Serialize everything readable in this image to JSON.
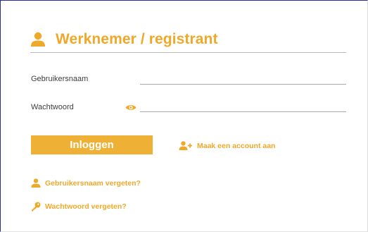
{
  "header": {
    "title": "Werknemer / registrant",
    "icon": "user-icon"
  },
  "form": {
    "username_label": "Gebruikersnaam",
    "username_value": "",
    "password_label": "Wachtwoord",
    "password_value": "",
    "password_toggle_icon": "eye-icon"
  },
  "actions": {
    "login_label": "Inloggen",
    "create_account_label": "Maak een account aan",
    "create_account_icon": "user-plus-icon"
  },
  "links": {
    "forgot_username": "Gebruikersnaam vergeten?",
    "forgot_username_icon": "user-icon",
    "forgot_password": "Wachtwoord vergeten?",
    "forgot_password_icon": "key-icon"
  },
  "colors": {
    "accent": "#efa92a",
    "button": "#efb135",
    "text": "#3d3d3d"
  }
}
